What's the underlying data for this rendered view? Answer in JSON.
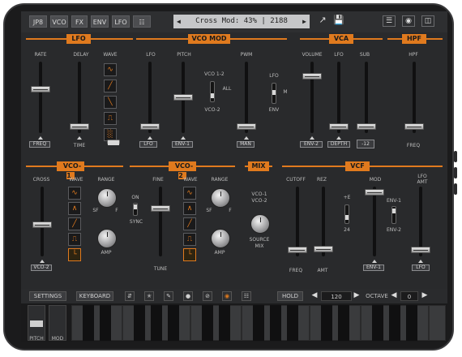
{
  "toolbar": {
    "tabs": [
      "JP8",
      "VCO",
      "FX",
      "ENV",
      "LFO",
      "☷"
    ],
    "preset_name": "Cross Mod: 43% | 2188",
    "icons": [
      "preset-prev-icon",
      "preset-next-icon",
      "share-icon",
      "save-icon",
      "mixer-icon",
      "record-icon",
      "layout-icon"
    ]
  },
  "lfo": {
    "header": "LFO",
    "rate": "RATE",
    "delay": "DELAY",
    "wave": "WAVE",
    "freq": "FREQ",
    "time": "TIME",
    "wave_icons": [
      "∿",
      "╱",
      "╲",
      "⎍",
      "░"
    ],
    "rate_level": 0.62,
    "delay_level": 0.05
  },
  "vcomod": {
    "header": "VCO MOD",
    "lfo": "LFO",
    "pitch": "PITCH",
    "pwm": "PWM",
    "vco12": "VCO 1-2",
    "all": "ALL",
    "vco2": "VCO-2",
    "lfo2": "LFO",
    "m": "M",
    "env": "ENV",
    "lfo_tag": "LFO",
    "env1_tag": "ENV-1",
    "man_tag": "MAN",
    "lfo_level": 0.05,
    "env_level": 0.5,
    "pwm_level": 0.05
  },
  "vca": {
    "header": "VCA",
    "volume": "VOLUME",
    "lfo": "LFO",
    "sub": "SUB",
    "env2_tag": "ENV-2",
    "depth_tag": "DEPTH",
    "sub_value": "-12",
    "volume_level": 0.82,
    "lfo_level": 0.05,
    "sub_level": 0.05
  },
  "hpf": {
    "header": "HPF",
    "hpf": "HPF",
    "freq": "FREQ",
    "hpf_level": 0.05
  },
  "vco1": {
    "header": "VCO-1",
    "cross": "CROSS",
    "wave": "WAVE",
    "range": "RANGE",
    "tag": "VCO-2",
    "amp": "AMP",
    "sf": "SF",
    "f": "F",
    "wave_icons": [
      "∿",
      "∧",
      "╱",
      "⎍",
      "└"
    ],
    "cross_level": 0.45
  },
  "vco2": {
    "header": "VCO-2",
    "fine": "FINE",
    "wave": "WAVE",
    "range": "RANGE",
    "on": "ON",
    "sync": "SYNC",
    "tune": "TUNE",
    "amp": "AMP",
    "sf": "SF",
    "f": "F",
    "wave_icons": [
      "∿",
      "∧",
      "╱",
      "⎍",
      "└"
    ],
    "fine_level": 0.7
  },
  "mix": {
    "header": "MIX",
    "vco1": "VCO-1",
    "vco2": "VCO-2",
    "source": "SOURCE",
    "mix": "MIX"
  },
  "vcf": {
    "header": "VCF",
    "cutoff": "CUTOFF",
    "rez": "REZ",
    "mod": "MOD",
    "lfo_amt": "LFO\nAMT",
    "plus": "+E",
    "twofour": "24",
    "env1": "ENV-1",
    "env2": "ENV-2",
    "freq": "FREQ",
    "amt": "AMT",
    "env1_tag": "ENV-1",
    "lfo_tag": "LFO",
    "cutoff_level": 0.05,
    "rez_level": 0.07,
    "mod_level": 0.96,
    "lfoamt_level": 0.05
  },
  "bottom": {
    "settings": "SETTINGS",
    "keyboard": "KEYBOARD",
    "hold": "HOLD",
    "tempo": "120",
    "octave_label": "OCTAVE",
    "octave": "0",
    "icons": [
      "sort-icon",
      "bluetooth-icon",
      "pencil-icon",
      "dot-icon",
      "forbid-icon",
      "record-dot-icon",
      "piano-icon"
    ]
  },
  "wheels": {
    "pitch": "PITCH",
    "mod": "MOD"
  },
  "colors": {
    "accent": "#e07a1e",
    "panel": "#292a2c"
  }
}
